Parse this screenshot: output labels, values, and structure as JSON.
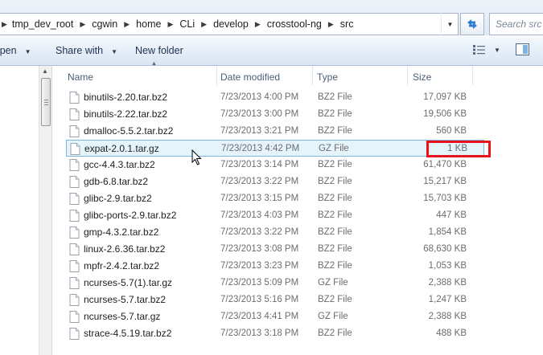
{
  "address_bar": {
    "breadcrumbs": [
      "tmp_dev_root",
      "cgwin",
      "home",
      "CLi",
      "develop",
      "crosstool-ng",
      "src"
    ],
    "search_placeholder": "Search src"
  },
  "command_bar": {
    "open_label": "Open",
    "share_label": "Share with",
    "new_folder_label": "New folder"
  },
  "columns": {
    "name": "Name",
    "date": "Date modified",
    "type": "Type",
    "size": "Size"
  },
  "files": [
    {
      "name": "binutils-2.20.tar.bz2",
      "date": "7/23/2013 4:00 PM",
      "type": "BZ2 File",
      "size": "17,097 KB"
    },
    {
      "name": "binutils-2.22.tar.bz2",
      "date": "7/23/2013 3:00 PM",
      "type": "BZ2 File",
      "size": "19,506 KB"
    },
    {
      "name": "dmalloc-5.5.2.tar.bz2",
      "date": "7/23/2013 3:21 PM",
      "type": "BZ2 File",
      "size": "560 KB"
    },
    {
      "name": "expat-2.0.1.tar.gz",
      "date": "7/23/2013 4:42 PM",
      "type": "GZ File",
      "size": "1 KB"
    },
    {
      "name": "gcc-4.4.3.tar.bz2",
      "date": "7/23/2013 3:14 PM",
      "type": "BZ2 File",
      "size": "61,470 KB"
    },
    {
      "name": "gdb-6.8.tar.bz2",
      "date": "7/23/2013 3:22 PM",
      "type": "BZ2 File",
      "size": "15,217 KB"
    },
    {
      "name": "glibc-2.9.tar.bz2",
      "date": "7/23/2013 3:15 PM",
      "type": "BZ2 File",
      "size": "15,703 KB"
    },
    {
      "name": "glibc-ports-2.9.tar.bz2",
      "date": "7/23/2013 4:03 PM",
      "type": "BZ2 File",
      "size": "447 KB"
    },
    {
      "name": "gmp-4.3.2.tar.bz2",
      "date": "7/23/2013 3:22 PM",
      "type": "BZ2 File",
      "size": "1,854 KB"
    },
    {
      "name": "linux-2.6.36.tar.bz2",
      "date": "7/23/2013 3:08 PM",
      "type": "BZ2 File",
      "size": "68,630 KB"
    },
    {
      "name": "mpfr-2.4.2.tar.bz2",
      "date": "7/23/2013 3:23 PM",
      "type": "BZ2 File",
      "size": "1,053 KB"
    },
    {
      "name": "ncurses-5.7(1).tar.gz",
      "date": "7/23/2013 5:09 PM",
      "type": "GZ File",
      "size": "2,388 KB"
    },
    {
      "name": "ncurses-5.7.tar.bz2",
      "date": "7/23/2013 5:16 PM",
      "type": "BZ2 File",
      "size": "1,247 KB"
    },
    {
      "name": "ncurses-5.7.tar.gz",
      "date": "7/23/2013 4:41 PM",
      "type": "GZ File",
      "size": "2,388 KB"
    },
    {
      "name": "strace-4.5.19.tar.bz2",
      "date": "7/23/2013 3:18 PM",
      "type": "BZ2 File",
      "size": "488 KB"
    }
  ],
  "selected_index": 3,
  "colors": {
    "selection_fill": "#e5f3fb",
    "selection_border": "#7ab7e6",
    "highlight_box": "#e8121d"
  },
  "icons": {
    "refresh": "refresh-icon",
    "view": "view-options-icon",
    "preview": "preview-pane-icon",
    "file": "file-icon"
  }
}
